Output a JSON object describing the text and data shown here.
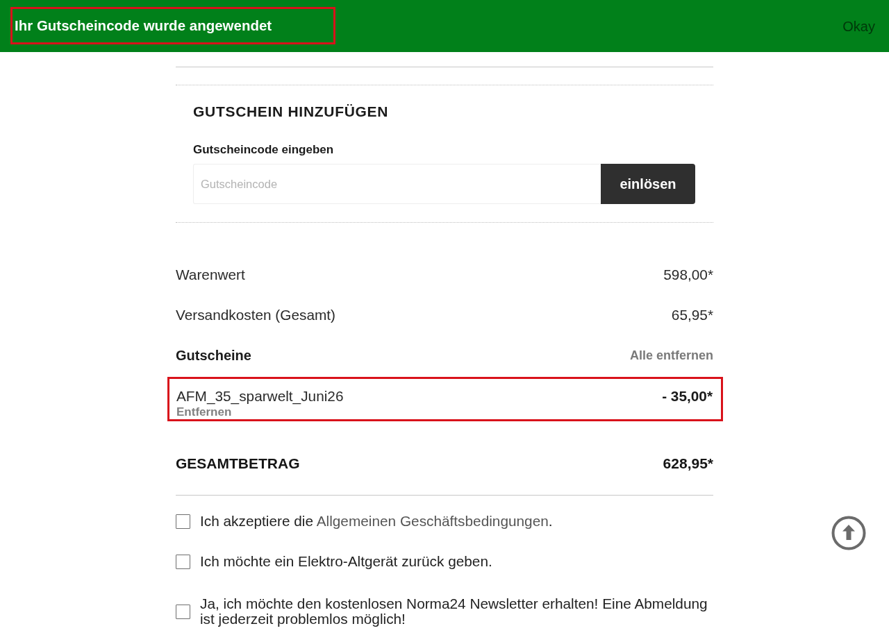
{
  "notification": {
    "message": "Ihr Gutscheincode wurde angewendet",
    "highlighted": true,
    "action": "Okay"
  },
  "coupon_form": {
    "title": "GUTSCHEIN HINZUFÜGEN",
    "label": "Gutscheincode eingeben",
    "placeholder": "Gutscheincode",
    "button": "einlösen"
  },
  "summary": {
    "rows": [
      {
        "label": "Warenwert",
        "value": "598,00*"
      },
      {
        "label": "Versandkosten (Gesamt)",
        "value": "65,95*"
      }
    ],
    "vouchers": {
      "title": "Gutscheine",
      "remove_all": "Alle entfernen",
      "items": [
        {
          "code": "AFM_35_sparwelt_Juni26",
          "amount": "- 35,00*",
          "remove": "Entfernen",
          "highlighted": true
        }
      ]
    },
    "total": {
      "label": "GESAMTBETRAG",
      "value": "628,95*"
    }
  },
  "consents": [
    {
      "text": "Ich akzeptiere die",
      "link": "Allgemeinen Geschäftsbedingungen",
      "text_after": ".",
      "checked": false
    },
    {
      "text": "Ich möchte ein Elektro-Altgerät zurück geben.",
      "checked": false
    },
    {
      "text": "Ja, ich möchte den kostenlosen Norma24 Newsletter erhalten! Eine Abmeldung ist jederzeit problemlos möglich!",
      "checked": false
    }
  ]
}
